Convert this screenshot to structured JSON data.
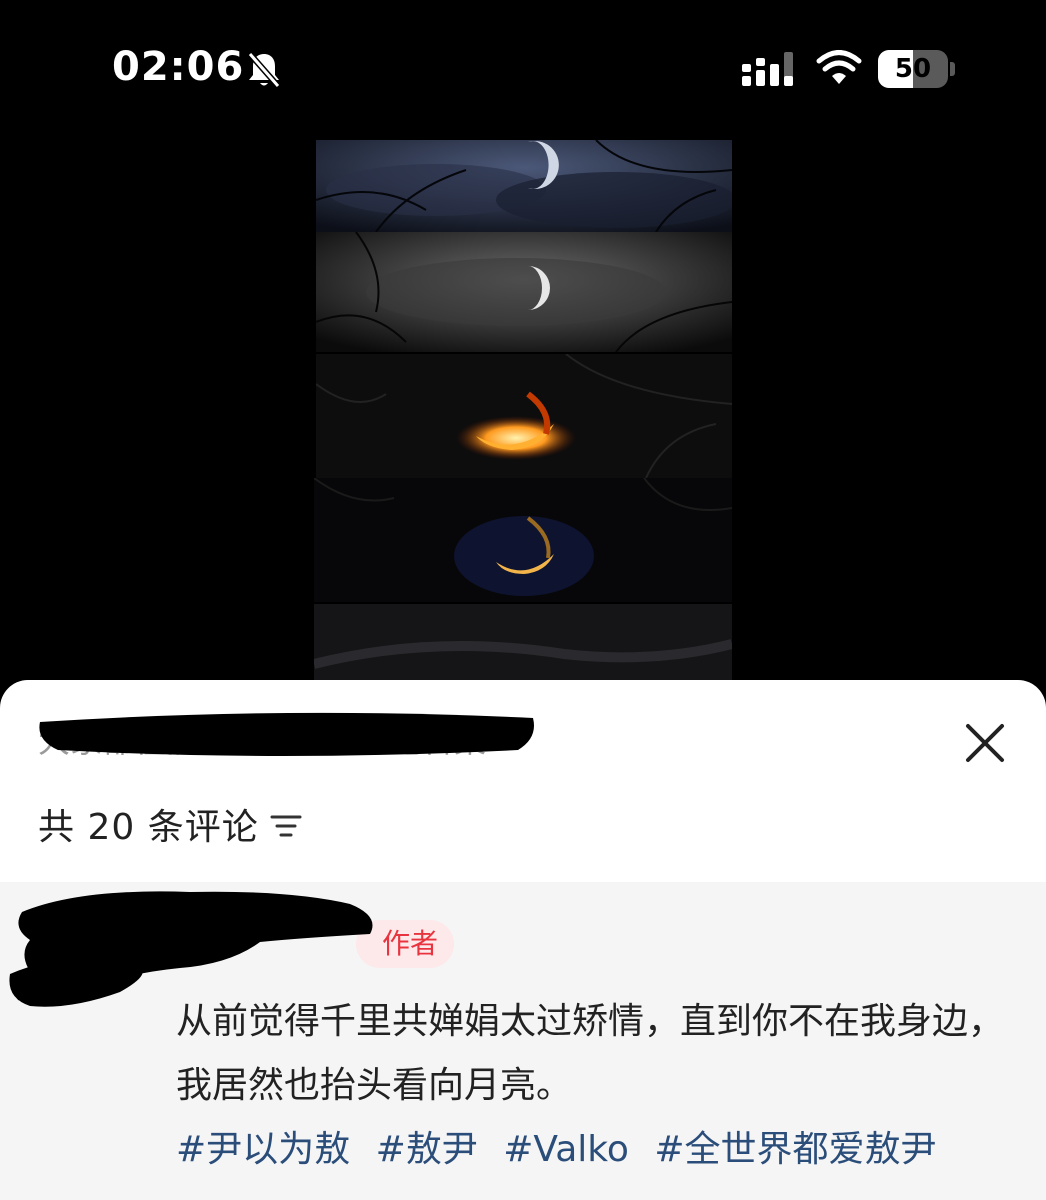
{
  "status_bar": {
    "time": "02:06",
    "battery_level": "50",
    "battery_fraction": 0.5,
    "icons": [
      "bell-slash-icon",
      "signal-icon",
      "wifi-icon",
      "battery-icon"
    ]
  },
  "comments_sheet": {
    "search_hint": "大家都在搜：敖尹冬瓜日记合集",
    "comment_count_label": "共 20 条评论",
    "close_icon": "close-icon",
    "sort_icon": "sort-filter-icon"
  },
  "comment": {
    "author_badge": "作者",
    "text": "从前觉得千里共婵娟太过矫情，直到你不在我身边，我居然也抬头看向月亮。",
    "hashtags": [
      "#尹以为敖",
      "#敖尹",
      "#Valko",
      "#全世界都爱敖尹"
    ]
  },
  "colors": {
    "author_badge_bg": "#fde8ea",
    "author_badge_text": "#e8343f",
    "hashtag": "#2a4d7a"
  }
}
